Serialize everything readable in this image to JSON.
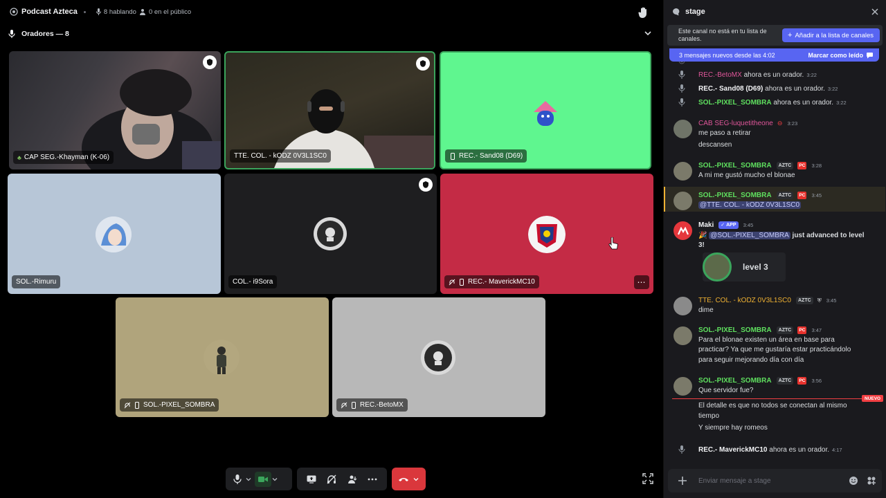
{
  "header": {
    "title": "Podcast Azteca",
    "speaking": "8 hablando",
    "audience": "0 en el público"
  },
  "speakers": {
    "label": "Oradores — 8"
  },
  "tiles": [
    {
      "name": "CAP SEG.-Khayman (K-06)",
      "prefix_icon": "plant-icon"
    },
    {
      "name": "TTE. COL. - kODZ 0V3L1SC0"
    },
    {
      "name": "REC.- Sand08 (D69)",
      "prefix_icon": "mobile-icon"
    },
    {
      "name": "SOL.-Rimuru"
    },
    {
      "name": "COL.- i9Sora"
    },
    {
      "name": "REC.- MaverickMC10"
    },
    {
      "name": "SOL.-PIXEL_SOMBRA"
    },
    {
      "name": "REC.-BetoMX"
    }
  ],
  "colors": {
    "green_tile": "#5ff68f",
    "blue_tile": "#b7c6d7",
    "dark_tile": "#1e1e20",
    "red_tile": "#c42b45",
    "khaki_tile": "#b0a47c",
    "gray_tile": "#b8b8b8",
    "speaking_border": "#3ba55c",
    "blurple": "#5865f2",
    "hangup": "#da373c"
  },
  "chat": {
    "channel": "stage",
    "notice_text": "Este canal no está en tu lista de canales.",
    "notice_button": "Añadir a la lista de canales",
    "new_messages": "3 mensajes nuevos desde las 4:02",
    "mark_read": "Marcar como leído",
    "system_messages": [
      {
        "user": "REC.-BetoMX",
        "text": "ahora es un orador.",
        "time": "3:22"
      },
      {
        "user": "REC.- Sand08 (D69)",
        "text": "ahora es un orador.",
        "time": "3:22"
      },
      {
        "user": "SOL.-PIXEL_SOMBRA",
        "text": "ahora es un orador.",
        "time": "3:22"
      },
      {
        "user": "REC.- MaverickMC10",
        "text": "ahora es un orador.",
        "time": "4:17"
      }
    ],
    "messages": [
      {
        "user": "CAB SEG-luquetitheone",
        "time": "3:23",
        "lines": [
          "me paso a retirar",
          "descansen"
        ]
      },
      {
        "user": "SOL.-PIXEL_SOMBRA",
        "tag": "AZTC",
        "time": "3:28",
        "lines": [
          "A mi me gustó mucho el blonae"
        ]
      },
      {
        "user": "SOL.-PIXEL_SOMBRA",
        "tag": "AZTC",
        "time": "3:45",
        "mention": "@TTE. COL. - kODZ 0V3L1SC0"
      },
      {
        "user": "Maki",
        "app": "APP",
        "time": "3:45",
        "mention": "@SOL.-PIXEL_SOMBRA",
        "text": "just advanced to level 3!",
        "level_card": "level 3"
      },
      {
        "user": "TTE. COL. - kODZ 0V3L1SC0",
        "tag": "AZTC",
        "time": "3:45",
        "lines": [
          "dime"
        ]
      },
      {
        "user": "SOL.-PIXEL_SOMBRA",
        "tag": "AZTC",
        "time": "3:47",
        "lines": [
          "Para el blonae existen un área en base para",
          "practicar? Ya que me gustaría estar practicándolo",
          "para seguir mejorando día con día"
        ]
      },
      {
        "user": "SOL.-PIXEL_SOMBRA",
        "tag": "AZTC",
        "time": "3:56",
        "lines": [
          "Que servidor fue?"
        ]
      }
    ],
    "nuevo": "NUEVO",
    "after_lines": [
      "El detalle es que no todos se conectan al mismo",
      "tiempo",
      "Y siempre hay romeos"
    ],
    "composer_placeholder": "Enviar mensaje a stage"
  }
}
